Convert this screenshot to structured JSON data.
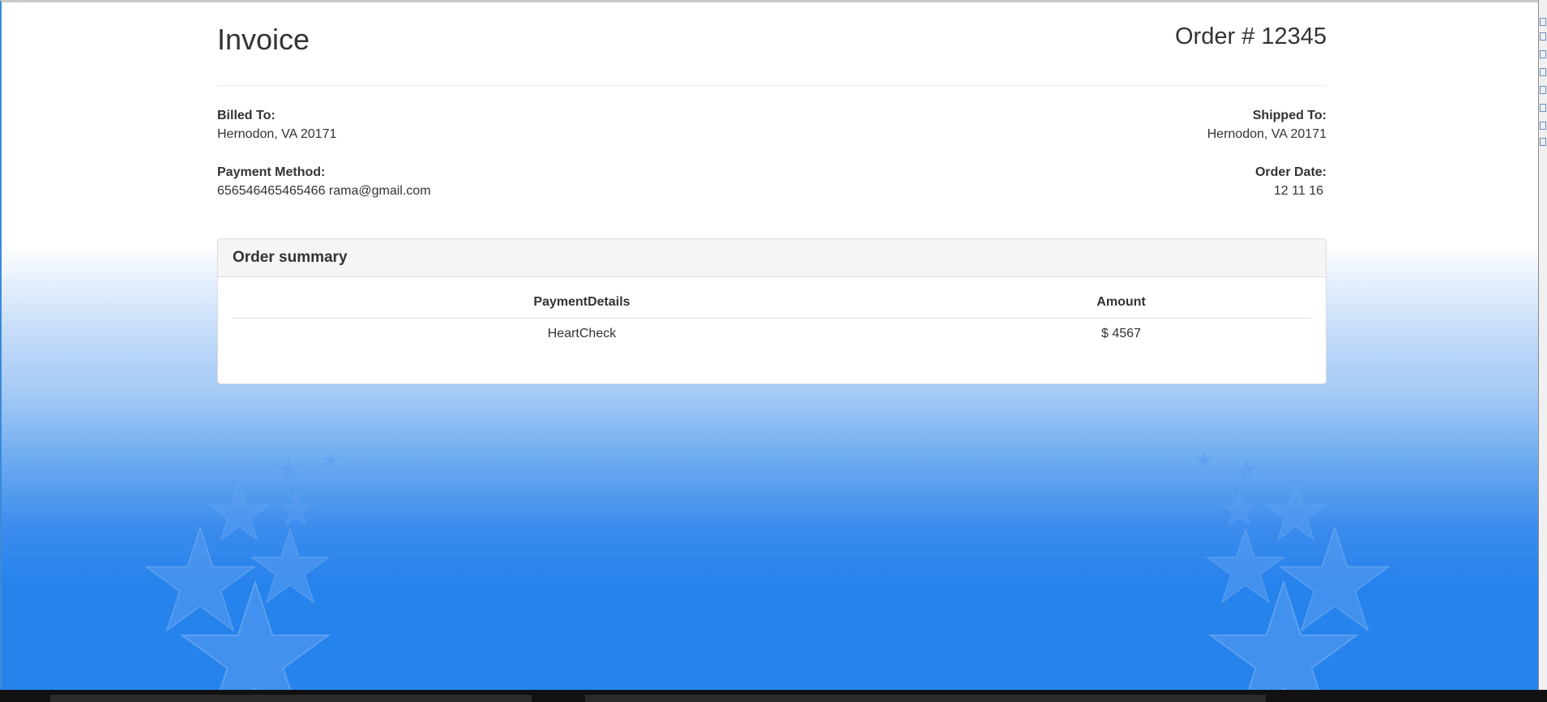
{
  "invoice": {
    "title": "Invoice",
    "order_number": "Order # 12345"
  },
  "billed_to": {
    "label": "Billed To:",
    "address": "Hernodon, VA 20171"
  },
  "shipped_to": {
    "label": "Shipped To:",
    "address": "Hernodon, VA 20171"
  },
  "payment_method": {
    "label": "Payment Method:",
    "value": "656546465465466 rama@gmail.com"
  },
  "order_date": {
    "label": "Order Date:",
    "value": "12 11 16"
  },
  "order_summary": {
    "title": "Order summary",
    "columns": [
      "PaymentDetails",
      "Amount"
    ],
    "rows": [
      {
        "payment_details": "HeartCheck",
        "amount": "$ 4567"
      }
    ]
  },
  "colors": {
    "background_blue": "#2683ec",
    "text": "#333333",
    "panel_heading": "#f5f5f5"
  }
}
